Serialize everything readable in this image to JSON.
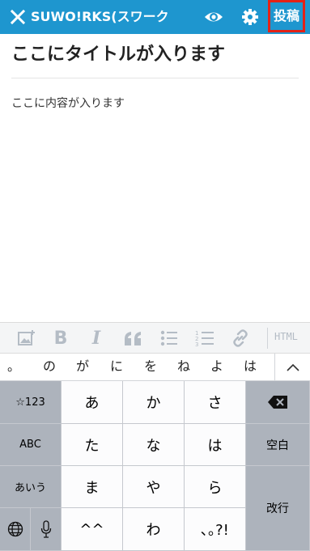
{
  "header": {
    "site_title": "SUWO!RKS(スワーク...",
    "post_label": "投稿",
    "colors": {
      "bar": "#1e96cf",
      "highlight": "#e32217"
    },
    "icons": [
      "close-icon",
      "eye-icon",
      "gear-icon"
    ]
  },
  "editor": {
    "title": "ここにタイトルが入ります",
    "body": "ここに内容が入ります"
  },
  "toolbar": {
    "icons": [
      "image-icon",
      "bold-icon",
      "italic-icon",
      "quote-icon",
      "bullet-list-icon",
      "numbered-list-icon",
      "link-icon"
    ],
    "bold_glyph": "B",
    "italic_glyph": "I",
    "html_label": "HTML"
  },
  "candidates": [
    "。",
    "の",
    "が",
    "に",
    "を",
    "ね",
    "よ",
    "は"
  ],
  "keyboard": {
    "row1": {
      "left": "☆123",
      "keys": [
        "あ",
        "か",
        "さ"
      ]
    },
    "row2": {
      "left": "ABC",
      "keys": [
        "た",
        "な",
        "は"
      ],
      "right": "空白"
    },
    "row3": {
      "left": "あいう",
      "keys": [
        "ま",
        "や",
        "ら"
      ]
    },
    "row4": {
      "keys": [
        "^^",
        "わ",
        "､｡?!"
      ]
    },
    "enter": "改行"
  }
}
